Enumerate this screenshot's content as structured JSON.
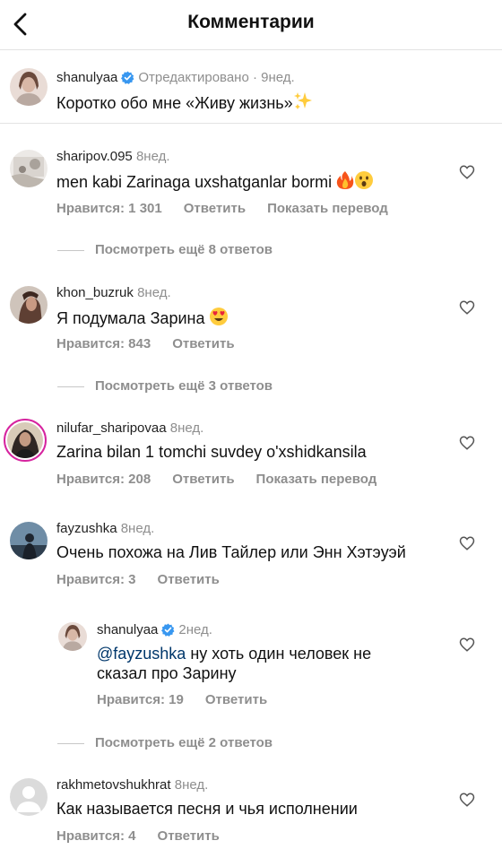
{
  "header": {
    "title": "Комментарии"
  },
  "caption": {
    "username": "shanulyaa",
    "edited": "Отредактировано",
    "age": "· 9нед.",
    "text": "Коротко обо мне «Живу жизнь»"
  },
  "comments": [
    {
      "username": "sharipov.095",
      "age": "8нед.",
      "text": "men kabi  Zarinaga uxshatganlar bormi",
      "likes": "Нравится: 1 301",
      "reply": "Ответить",
      "translate": "Показать перевод",
      "more": "Посмотреть ещё 8 ответов"
    },
    {
      "username": "khon_buzruk",
      "age": "8нед.",
      "text": "Я подумала Зарина",
      "likes": "Нравится: 843",
      "reply": "Ответить",
      "more": "Посмотреть ещё 3 ответов"
    },
    {
      "username": "nilufar_sharipovaa",
      "age": "8нед.",
      "text": "Zarina bilan 1 tomchi suvdey o'xshidkansila",
      "likes": "Нравится: 208",
      "reply": "Ответить",
      "translate": "Показать перевод"
    },
    {
      "username": "fayzushka",
      "age": "8нед.",
      "text": "Очень похожа на Лив Тайлер или Энн Хэтэуэй",
      "likes": "Нравится: 3",
      "reply": "Ответить"
    },
    {
      "username": "rakhmetovshukhrat",
      "age": "8нед.",
      "text": "Как называется песня и чья исполнении",
      "likes": "Нравится: 4",
      "reply": "Ответить"
    }
  ],
  "reply": {
    "username": "shanulyaa",
    "age": "2нед.",
    "mention": "@fayzushka",
    "text_line1": " ну хоть один человек не",
    "text_line2": "сказал про Зарину",
    "likes": "Нравится: 19",
    "reply": "Ответить",
    "more": "Посмотреть ещё 2 ответов"
  }
}
